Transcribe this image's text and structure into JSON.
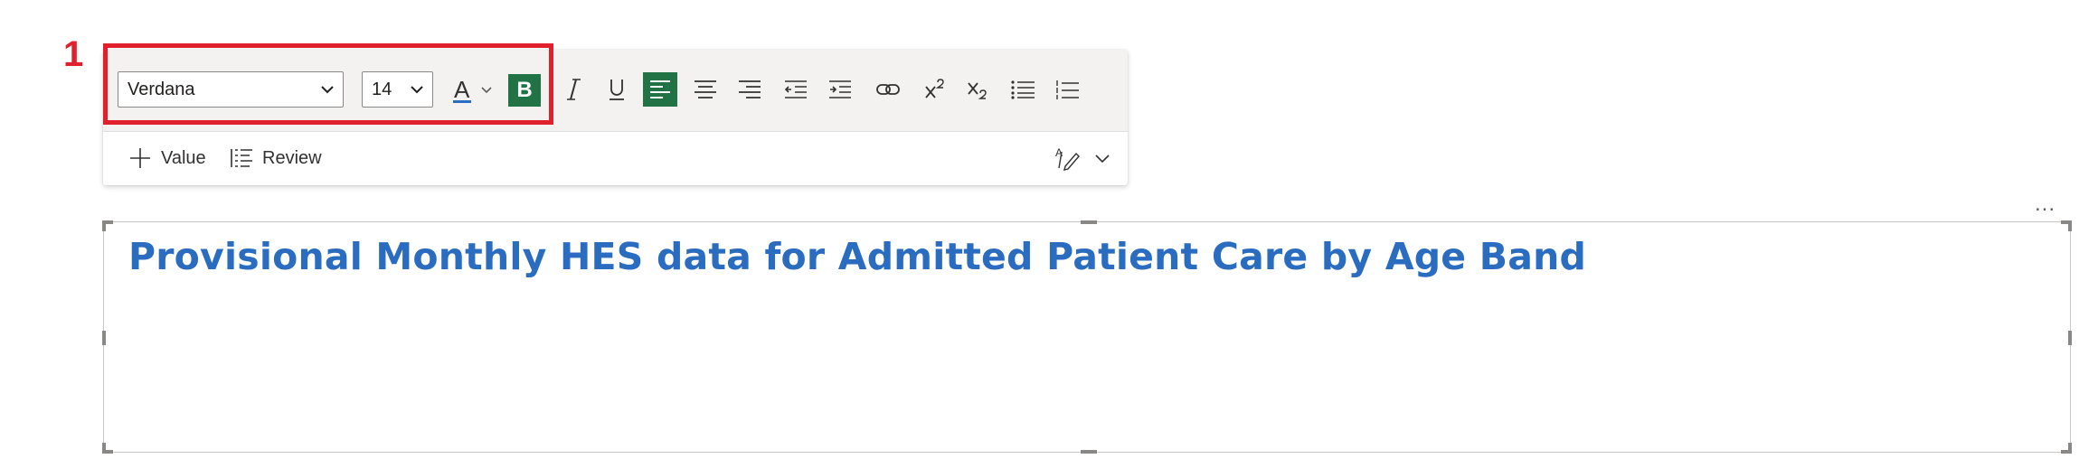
{
  "callout": {
    "number": "1"
  },
  "toolbar": {
    "font_family": "Verdana",
    "font_size": "14",
    "font_color_glyph": "A",
    "bold_glyph": "B",
    "accent_color": "#217346",
    "font_color_underline": "#2a6cc0",
    "buttons": [
      {
        "name": "italic-icon"
      },
      {
        "name": "underline-icon"
      },
      {
        "name": "align-left-icon"
      },
      {
        "name": "align-center-icon"
      },
      {
        "name": "align-right-icon"
      },
      {
        "name": "decrease-indent-icon"
      },
      {
        "name": "increase-indent-icon"
      },
      {
        "name": "link-icon"
      },
      {
        "name": "superscript-icon"
      },
      {
        "name": "subscript-icon"
      },
      {
        "name": "bulleted-list-icon"
      },
      {
        "name": "numbered-list-icon"
      }
    ],
    "value_label": "Value",
    "review_label": "Review"
  },
  "visual": {
    "more_options": "...",
    "title": "Provisional Monthly HES data for Admitted Patient Care by Age Band",
    "title_color": "#2a6cc0"
  }
}
